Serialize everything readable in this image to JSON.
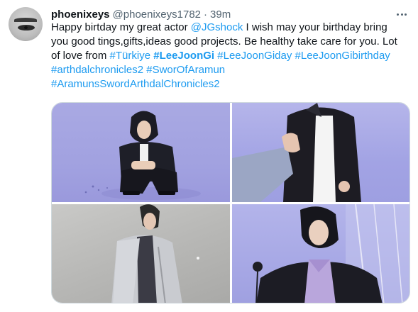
{
  "author": {
    "name": "phoenixeys",
    "handle": "@phoenixeys1782",
    "separator": "·",
    "time": "39m"
  },
  "tweet": {
    "line1": {
      "t1": "Happy birtday my great actor ",
      "mention": "@JGshock",
      "t2": " I wish may your birthday bring"
    },
    "line2": "you good tings,gifts,ideas good projects. Be healthy take care for you. Lot",
    "line3": {
      "t1": "of love from ",
      "tag1": "#Türkiye",
      "tag2": "#LeeJoonGi",
      "tag3": "#LeeJoonGiday",
      "tag4": "#LeeJoonGibirthday"
    },
    "line4": {
      "tag1": "#arthdalchronicles2",
      "tag2": "#SworOfAramun"
    },
    "line5": {
      "tag1": "#AramunsSwordArthdalChronicles2"
    }
  },
  "icons": {
    "more": "more-horizontal-icon"
  },
  "colors": {
    "link": "#1d9bf0",
    "secondary_text": "#536471",
    "photo_background": "#a3a3e2"
  }
}
